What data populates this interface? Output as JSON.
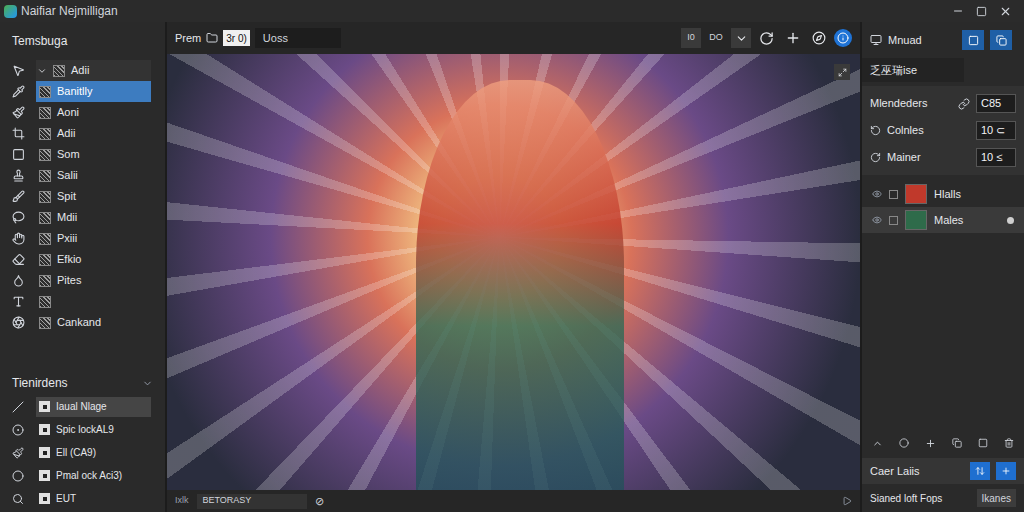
{
  "window": {
    "title": "Naifiar Nejmilligan"
  },
  "tools_panel": {
    "title": "Temsbuga",
    "items": [
      {
        "label": "Adii",
        "kind": "group",
        "expanded": true,
        "selected": false
      },
      {
        "label": "Banitlly",
        "kind": "item",
        "selected": true
      },
      {
        "label": "Aoni",
        "kind": "item",
        "selected": false
      },
      {
        "label": "Adii",
        "kind": "item",
        "selected": false
      },
      {
        "label": "Som",
        "kind": "item",
        "selected": false
      },
      {
        "label": "Salii",
        "kind": "item",
        "selected": false
      },
      {
        "label": "Spit",
        "kind": "item",
        "selected": false
      },
      {
        "label": "Mdii",
        "kind": "item",
        "selected": false
      },
      {
        "label": "Pxiii",
        "kind": "item",
        "selected": false
      },
      {
        "label": "Efkio",
        "kind": "item",
        "selected": false
      },
      {
        "label": "Pites",
        "kind": "item",
        "selected": false
      },
      {
        "label": "",
        "kind": "item",
        "selected": false
      },
      {
        "label": "Cankand",
        "kind": "item",
        "selected": false
      }
    ]
  },
  "lower_panel": {
    "title": "Tienirdens",
    "expanded": true,
    "items": [
      {
        "label": "Iaual Nlage",
        "selected": true
      },
      {
        "label": "Spic lockAL9",
        "selected": false
      },
      {
        "label": "Ell (CA9)",
        "selected": false
      },
      {
        "label": "Pmal ock Aci3)",
        "selected": false
      },
      {
        "label": "EUT",
        "selected": false
      }
    ]
  },
  "toolbar": {
    "label": "Prem",
    "field": "3r 0)",
    "search": "Uoss",
    "buttons": [
      "I0",
      "DO"
    ]
  },
  "status_bar": {
    "label": "Ixlk",
    "field": "BETORASY",
    "symbol": "⊘"
  },
  "right_panel": {
    "title": "Mnuad",
    "subtitle": "乏巫瑞ise",
    "properties": [
      {
        "label": "Mlendeders",
        "value": "C85"
      },
      {
        "label": "Colnles",
        "value": "10 ⊂"
      },
      {
        "label": "Mainer",
        "value": "10 ≤"
      }
    ],
    "layers": [
      {
        "name": "Hlalls",
        "selected": false,
        "color": "#c0392b"
      },
      {
        "name": "Males",
        "selected": true,
        "color": "#2e6b4a"
      }
    ],
    "footer": {
      "label": "Caer Laiis",
      "options_label": "Sianed loft Fops",
      "options_button": "Ikanes"
    }
  }
}
